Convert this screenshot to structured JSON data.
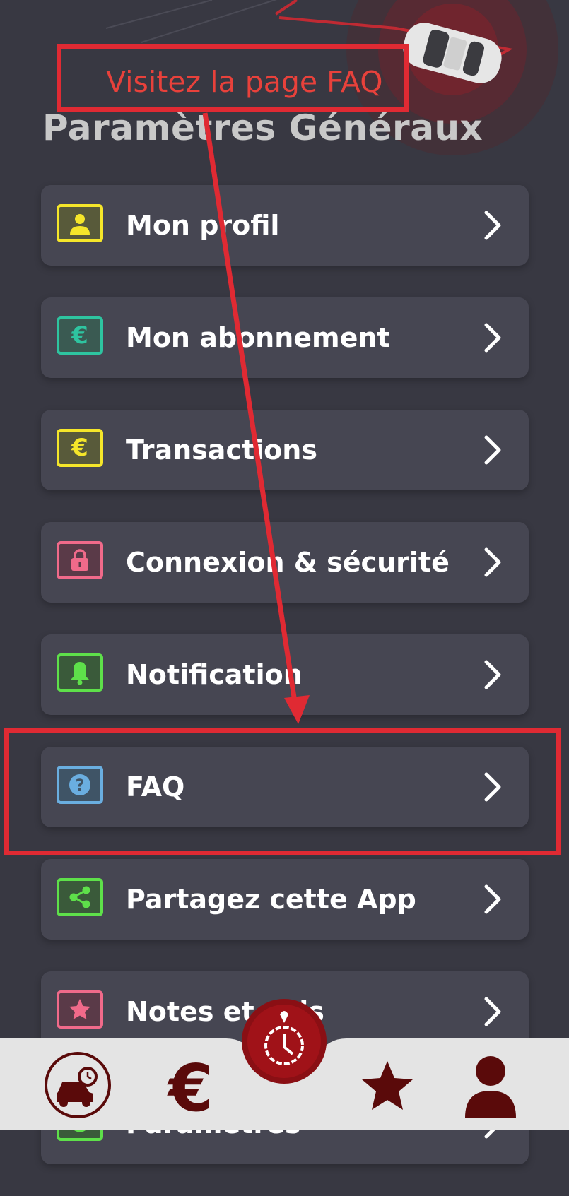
{
  "page_title": "Paramètres Généraux",
  "annotation": {
    "callout_text": "Visitez la page FAQ"
  },
  "menu": {
    "items": [
      {
        "label": "Mon profil",
        "icon": "profile-card-icon",
        "color": "#f5e62a"
      },
      {
        "label": "Mon abonnement",
        "icon": "euro-icon",
        "color": "#2ec4a0"
      },
      {
        "label": "Transactions",
        "icon": "euro-icon",
        "color": "#f5e62a"
      },
      {
        "label": "Connexion & sécurité",
        "icon": "lock-icon",
        "color": "#f06a8a"
      },
      {
        "label": "Notification",
        "icon": "bell-icon",
        "color": "#5ee04a"
      },
      {
        "label": "FAQ",
        "icon": "question-icon",
        "color": "#6aaee0"
      },
      {
        "label": "Partagez cette App",
        "icon": "share-icon",
        "color": "#5ee04a"
      },
      {
        "label": "Notes et avis",
        "icon": "star-icon",
        "color": "#f06a8a"
      },
      {
        "label": "Paramètres",
        "icon": "settings-icon",
        "color": "#5ee04a"
      }
    ]
  },
  "bottom_nav": {
    "items": [
      {
        "icon": "car-clock-icon"
      },
      {
        "icon": "euro-icon"
      },
      {
        "icon": "timer-center-icon"
      },
      {
        "icon": "star-icon"
      },
      {
        "icon": "user-icon"
      }
    ]
  },
  "colors": {
    "background": "#383842",
    "card": "#464652",
    "annotation_red": "#e02a33",
    "nav_dark_red": "#5a0a0a"
  }
}
